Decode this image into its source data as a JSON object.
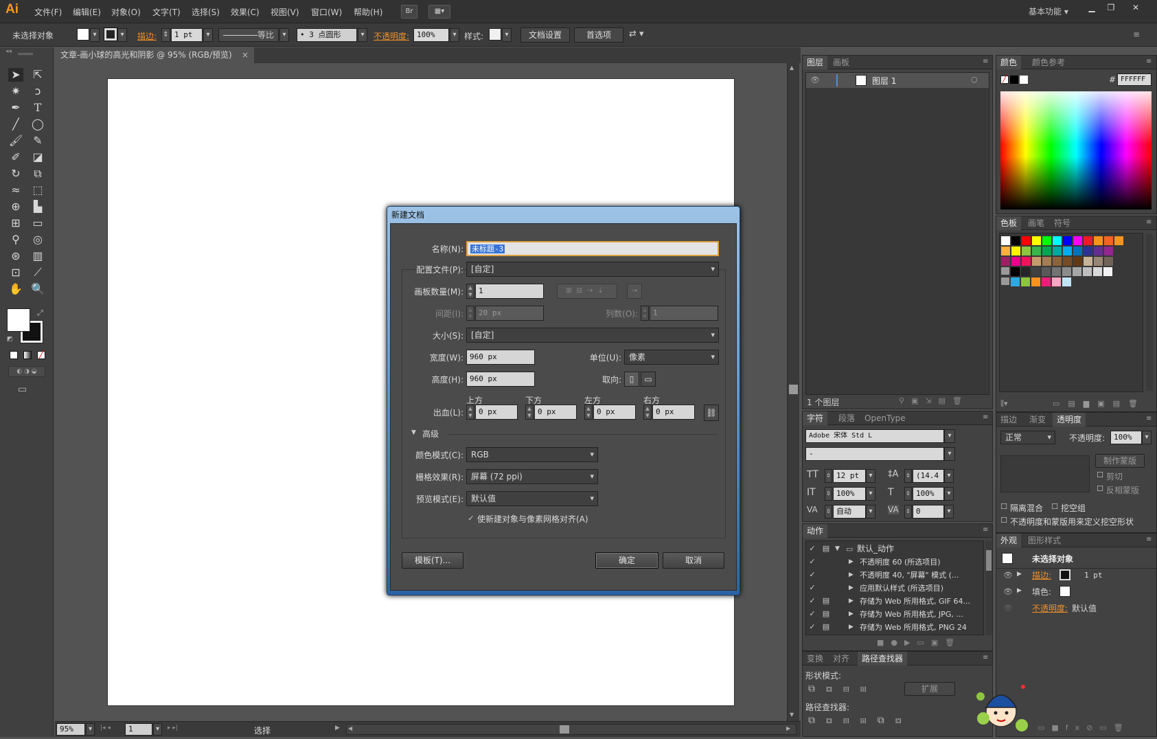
{
  "app": {
    "logo": "Ai"
  },
  "menu": [
    "文件(F)",
    "编辑(E)",
    "对象(O)",
    "文字(T)",
    "选择(S)",
    "效果(C)",
    "视图(V)",
    "窗口(W)",
    "帮助(H)"
  ],
  "menubar": {
    "bridge": "Br",
    "workspace": "基本功能",
    "minimize": "▁",
    "restore": "❐",
    "close": "✕"
  },
  "control": {
    "selection": "未选择对象",
    "stroke_label": "描边:",
    "stroke_value": "1 pt",
    "line_style": "等比",
    "brush": "3 点圆形",
    "opacity_label": "不透明度:",
    "opacity_value": "100%",
    "style_label": "样式:",
    "doc_setup": "文档设置",
    "prefs": "首选项"
  },
  "document": {
    "tab_title": "文章-画小球的高光和阴影 @ 95% (RGB/预览)",
    "close": "×"
  },
  "status": {
    "zoom": "95%",
    "artboard": "1",
    "mode": "选择"
  },
  "layers_panel": {
    "tabs": [
      "图层",
      "画板"
    ],
    "layer_name": "图层 1",
    "footer": "1 个图层"
  },
  "color_panel": {
    "tabs": [
      "颜色",
      "颜色参考"
    ],
    "hex_label": "#",
    "hex_value": "FFFFFF"
  },
  "swatches_panel": {
    "tabs": [
      "色板",
      "画笔",
      "符号"
    ]
  },
  "character_panel": {
    "tabs": [
      "字符",
      "段落",
      "OpenType"
    ],
    "font": "Adobe 宋体 Std L",
    "style": "-",
    "size": "12 pt",
    "leading": "(14.4",
    "hscale": "100%",
    "vscale": "100%",
    "kerning": "自动",
    "tracking": "0"
  },
  "transparency_panel": {
    "tabs": [
      "描边",
      "渐变",
      "透明度"
    ],
    "blend": "正常",
    "opacity_label": "不透明度:",
    "opacity_value": "100%",
    "make_mask": "制作蒙版",
    "clip": "剪切",
    "invert": "反相蒙版",
    "isolate": "隔离混合",
    "knockout": "挖空组",
    "define_knockout": "不透明度和蒙版用来定义挖空形状"
  },
  "actions_panel": {
    "tab": "动作",
    "set": "默认_动作",
    "items": [
      "不透明度 60 (所选项目)",
      "不透明度 40, \"屏幕\" 模式 (...",
      "应用默认样式 (所选项目)",
      "存储为 Web 所用格式, GIF 64...",
      "存储为 Web 所用格式, JPG, ...",
      "存储为 Web 所用格式, PNG 24"
    ]
  },
  "appearance_panel": {
    "tabs": [
      "外观",
      "图形样式"
    ],
    "title": "未选择对象",
    "stroke_label": "描边:",
    "stroke_value": "1 pt",
    "fill_label": "填色:",
    "opacity_label": "不透明度:",
    "opacity_value": "默认值"
  },
  "pathfinder_panel": {
    "tabs": [
      "变换",
      "对齐",
      "路径查找器"
    ],
    "shape_modes": "形状模式:",
    "expand": "扩展",
    "pathfinders": "路径查找器:"
  },
  "dialog": {
    "title": "新建文档",
    "name_label": "名称(N):",
    "name_value": "未标题-3",
    "profile_label": "配置文件(P):",
    "profile_value": "[自定]",
    "artboards_label": "画板数量(M):",
    "artboards_value": "1",
    "spacing_label": "间距(I):",
    "spacing_value": "20 px",
    "columns_label": "列数(O):",
    "columns_value": "1",
    "size_label": "大小(S):",
    "size_value": "[自定]",
    "width_label": "宽度(W):",
    "width_value": "960 px",
    "units_label": "单位(U):",
    "units_value": "像素",
    "height_label": "高度(H):",
    "height_value": "960 px",
    "orientation_label": "取向:",
    "bleed_label": "出血(L):",
    "bleed_top_label": "上方",
    "bleed_bottom_label": "下方",
    "bleed_left_label": "左方",
    "bleed_right_label": "右方",
    "bleed_top": "0 px",
    "bleed_bottom": "0 px",
    "bleed_left": "0 px",
    "bleed_right": "0 px",
    "advanced": "高级",
    "color_mode_label": "颜色模式(C):",
    "color_mode_value": "RGB",
    "raster_label": "栅格效果(R):",
    "raster_value": "屏幕 (72 ppi)",
    "preview_label": "预览模式(E):",
    "preview_value": "默认值",
    "align_pixel": "使新建对象与像素网格对齐(A)",
    "templates_btn": "模板(T)...",
    "ok_btn": "确定",
    "cancel_btn": "取消"
  },
  "colors": {
    "swatch_row1": [
      "#ffffff",
      "#000000",
      "#ff0000",
      "#ffff00",
      "#00ff00",
      "#00ffff",
      "#0000ff",
      "#ff00ff",
      "#ed1c24",
      "#f7941d",
      "#f26522",
      "#f7941d"
    ],
    "swatch_row2": [
      "#fbaf3f",
      "#fff200",
      "#8dc63f",
      "#39b54a",
      "#00a651",
      "#00a99d",
      "#00aeef",
      "#0072bc",
      "#2e3192",
      "#662d91",
      "#92278f"
    ],
    "swatch_row3": [
      "#9e1f63",
      "#ec008c",
      "#ed145b",
      "#c69c6d",
      "#a67c52",
      "#8c6239",
      "#754c24",
      "#603913",
      "#c7b299",
      "#998675",
      "#736357"
    ],
    "swatch_row4": [
      "#000000",
      "#262626",
      "#404040",
      "#595959",
      "#737373",
      "#8c8c8c",
      "#a6a6a6",
      "#bfbfbf",
      "#d9d9d9",
      "#f2f2f2"
    ],
    "swatch_row5": [
      "#29abe2",
      "#8cc63f",
      "#f7931e",
      "#ed1e79",
      "#f8a5c2",
      "#c1e4f5"
    ]
  }
}
